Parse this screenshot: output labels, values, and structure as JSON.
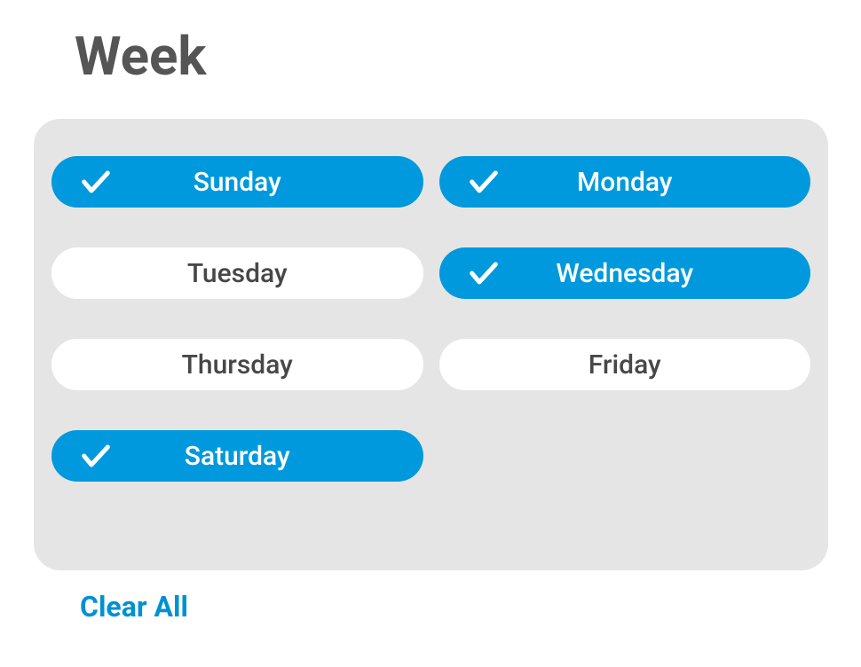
{
  "title": "Week",
  "days": [
    {
      "id": "sunday",
      "label": "Sunday",
      "selected": true
    },
    {
      "id": "monday",
      "label": "Monday",
      "selected": true
    },
    {
      "id": "tuesday",
      "label": "Tuesday",
      "selected": false
    },
    {
      "id": "wednesday",
      "label": "Wednesday",
      "selected": true
    },
    {
      "id": "thursday",
      "label": "Thursday",
      "selected": false
    },
    {
      "id": "friday",
      "label": "Friday",
      "selected": false
    },
    {
      "id": "saturday",
      "label": "Saturday",
      "selected": true
    }
  ],
  "clear_all_label": "Clear All",
  "colors": {
    "accent": "#0099dd",
    "card_bg": "#e5e5e5",
    "text_dark": "#474747",
    "link": "#0091d1"
  }
}
